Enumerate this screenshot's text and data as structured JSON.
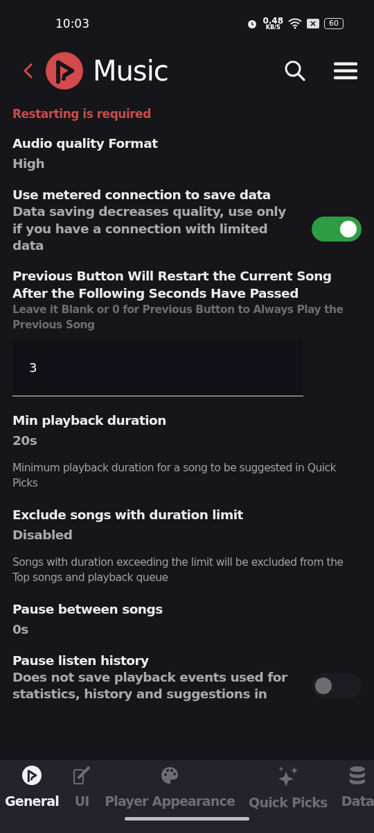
{
  "status_bar": {
    "time": "10:03",
    "speed": "0.48",
    "speed_unit": "KB/S",
    "battery": "60"
  },
  "header": {
    "title": "Music"
  },
  "notice": "Restarting is required",
  "settings": [
    {
      "kind": "value",
      "title": "Audio quality Format",
      "value": "High"
    },
    {
      "kind": "switch",
      "title": "Use metered connection to save data",
      "description": "Data saving decreases quality, use only if you have a connection with limited data",
      "on": true
    },
    {
      "kind": "input",
      "title": "Previous Button Will Restart the Current Song After the Following Seconds Have Passed",
      "hint": "Leave it Blank or 0 for Previous Button to Always Play the Previous Song",
      "value": "3"
    },
    {
      "kind": "value",
      "title": "Min playback duration",
      "value": "20s",
      "description": "Minimum playback duration for a song to be suggested in Quick Picks"
    },
    {
      "kind": "value",
      "title": "Exclude songs with duration limit",
      "value": "Disabled",
      "description": "Songs with duration exceeding the limit will be excluded from the Top songs and playback queue"
    },
    {
      "kind": "value",
      "title": "Pause between songs",
      "value": "0s"
    },
    {
      "kind": "switch",
      "title": "Pause listen history",
      "description": "Does not save playback events used for statistics, history and suggestions in",
      "on": false
    }
  ],
  "tabs": [
    {
      "label": "General",
      "selected": true
    },
    {
      "label": "UI",
      "selected": false
    },
    {
      "label": "Player Appearance",
      "selected": false
    },
    {
      "label": "Quick Picks",
      "selected": false
    },
    {
      "label": "Data",
      "selected": false
    }
  ]
}
